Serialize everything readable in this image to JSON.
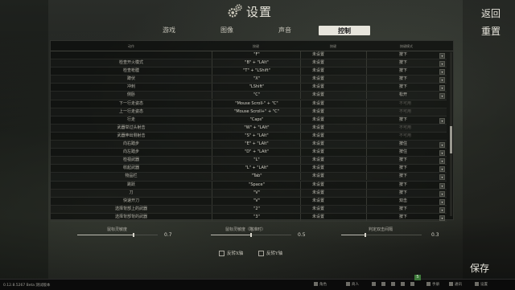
{
  "header": {
    "title": "设置",
    "back_label": "返回",
    "reset_label": "重置",
    "tabs": [
      {
        "label": "游戏",
        "active": false
      },
      {
        "label": "图像",
        "active": false
      },
      {
        "label": "声音",
        "active": false
      },
      {
        "label": "控制",
        "active": true
      }
    ]
  },
  "table": {
    "columns": [
      "动作",
      "按键",
      "按键",
      "按键模式"
    ],
    "rows": [
      {
        "name": "",
        "key": "\"F\"",
        "alt": "未设置",
        "mode": "按下"
      },
      {
        "name": "检查开火模式",
        "key": "\"B\" + \"LAlt\"",
        "alt": "未设置",
        "mode": "按下"
      },
      {
        "name": "检查枪膛",
        "key": "\"T\" + \"LShift\"",
        "alt": "未设置",
        "mode": "按下"
      },
      {
        "name": "蹲伏",
        "key": "\"X\"",
        "alt": "未设置",
        "mode": "按下"
      },
      {
        "name": "冲刺",
        "key": "\"LShift\"",
        "alt": "未设置",
        "mode": "按下"
      },
      {
        "name": "侧卧",
        "key": "\"C\"",
        "alt": "未设置",
        "mode": "松开"
      },
      {
        "name": "下一行走姿态",
        "key": "\"Mouse Scroll-\" + \"C\"",
        "alt": "未设置",
        "mode": "不可用",
        "mode_dim": true
      },
      {
        "name": "上一行走姿态",
        "key": "\"Mouse Scroll+\" + \"C\"",
        "alt": "未设置",
        "mode": "不可用",
        "mode_dim": true
      },
      {
        "name": "行走",
        "key": "\"Caps\"",
        "alt": "未设置",
        "mode": "按下"
      },
      {
        "name": "武器举过头射击",
        "key": "\"W\" + \"LAlt\"",
        "alt": "未设置",
        "mode": "不可用",
        "mode_dim": true
      },
      {
        "name": "武器伸出侧射击",
        "key": "\"S\" + \"LAlt\"",
        "alt": "未设置",
        "mode": "不可用",
        "mode_dim": true
      },
      {
        "name": "向右踏步",
        "key": "\"E\" + \"LAlt\"",
        "alt": "未设置",
        "mode": "按住"
      },
      {
        "name": "向左踏步",
        "key": "\"D\" + \"LAlt\"",
        "alt": "未设置",
        "mode": "按住"
      },
      {
        "name": "检视武器",
        "key": "\"L\"",
        "alt": "未设置",
        "mode": "按下"
      },
      {
        "name": "收起武器",
        "key": "\"L\" + \"LAlt\"",
        "alt": "未设置",
        "mode": "按下"
      },
      {
        "name": "物品栏",
        "key": "\"Tab\"",
        "alt": "未设置",
        "mode": "按下"
      },
      {
        "name": "跳跃",
        "key": "\"Space\"",
        "alt": "未设置",
        "mode": "按下"
      },
      {
        "name": "刀",
        "key": "\"V\"",
        "alt": "未设置",
        "mode": "按下"
      },
      {
        "name": "快速开刀",
        "key": "\"V\"",
        "alt": "未设置",
        "mode": "双击"
      },
      {
        "name": "选择背部上的武器",
        "key": "\"2\"",
        "alt": "未设置",
        "mode": "按下"
      },
      {
        "name": "选择背部背的武器",
        "key": "\"3\"",
        "alt": "未设置",
        "mode": "按下"
      }
    ]
  },
  "sliders": [
    {
      "label": "鼠标灵敏度",
      "value": "0.7",
      "fraction": 0.7
    },
    {
      "label": "鼠标灵敏度（瞄准时）",
      "value": "0.5",
      "fraction": 0.5
    },
    {
      "label": "判定双击间隔",
      "value": "0.3",
      "fraction": 0.3
    }
  ],
  "checkboxes": [
    {
      "label": "反转X轴",
      "checked": false
    },
    {
      "label": "反转Y轴",
      "checked": false
    }
  ],
  "save_label": "保存",
  "taskbar": {
    "build": "0.12.8.5267 Beta 测试版本",
    "items": [
      "角色",
      "商人",
      "",
      "",
      "",
      "",
      "",
      "手册",
      "通讯",
      "设置"
    ],
    "badge": "5"
  }
}
